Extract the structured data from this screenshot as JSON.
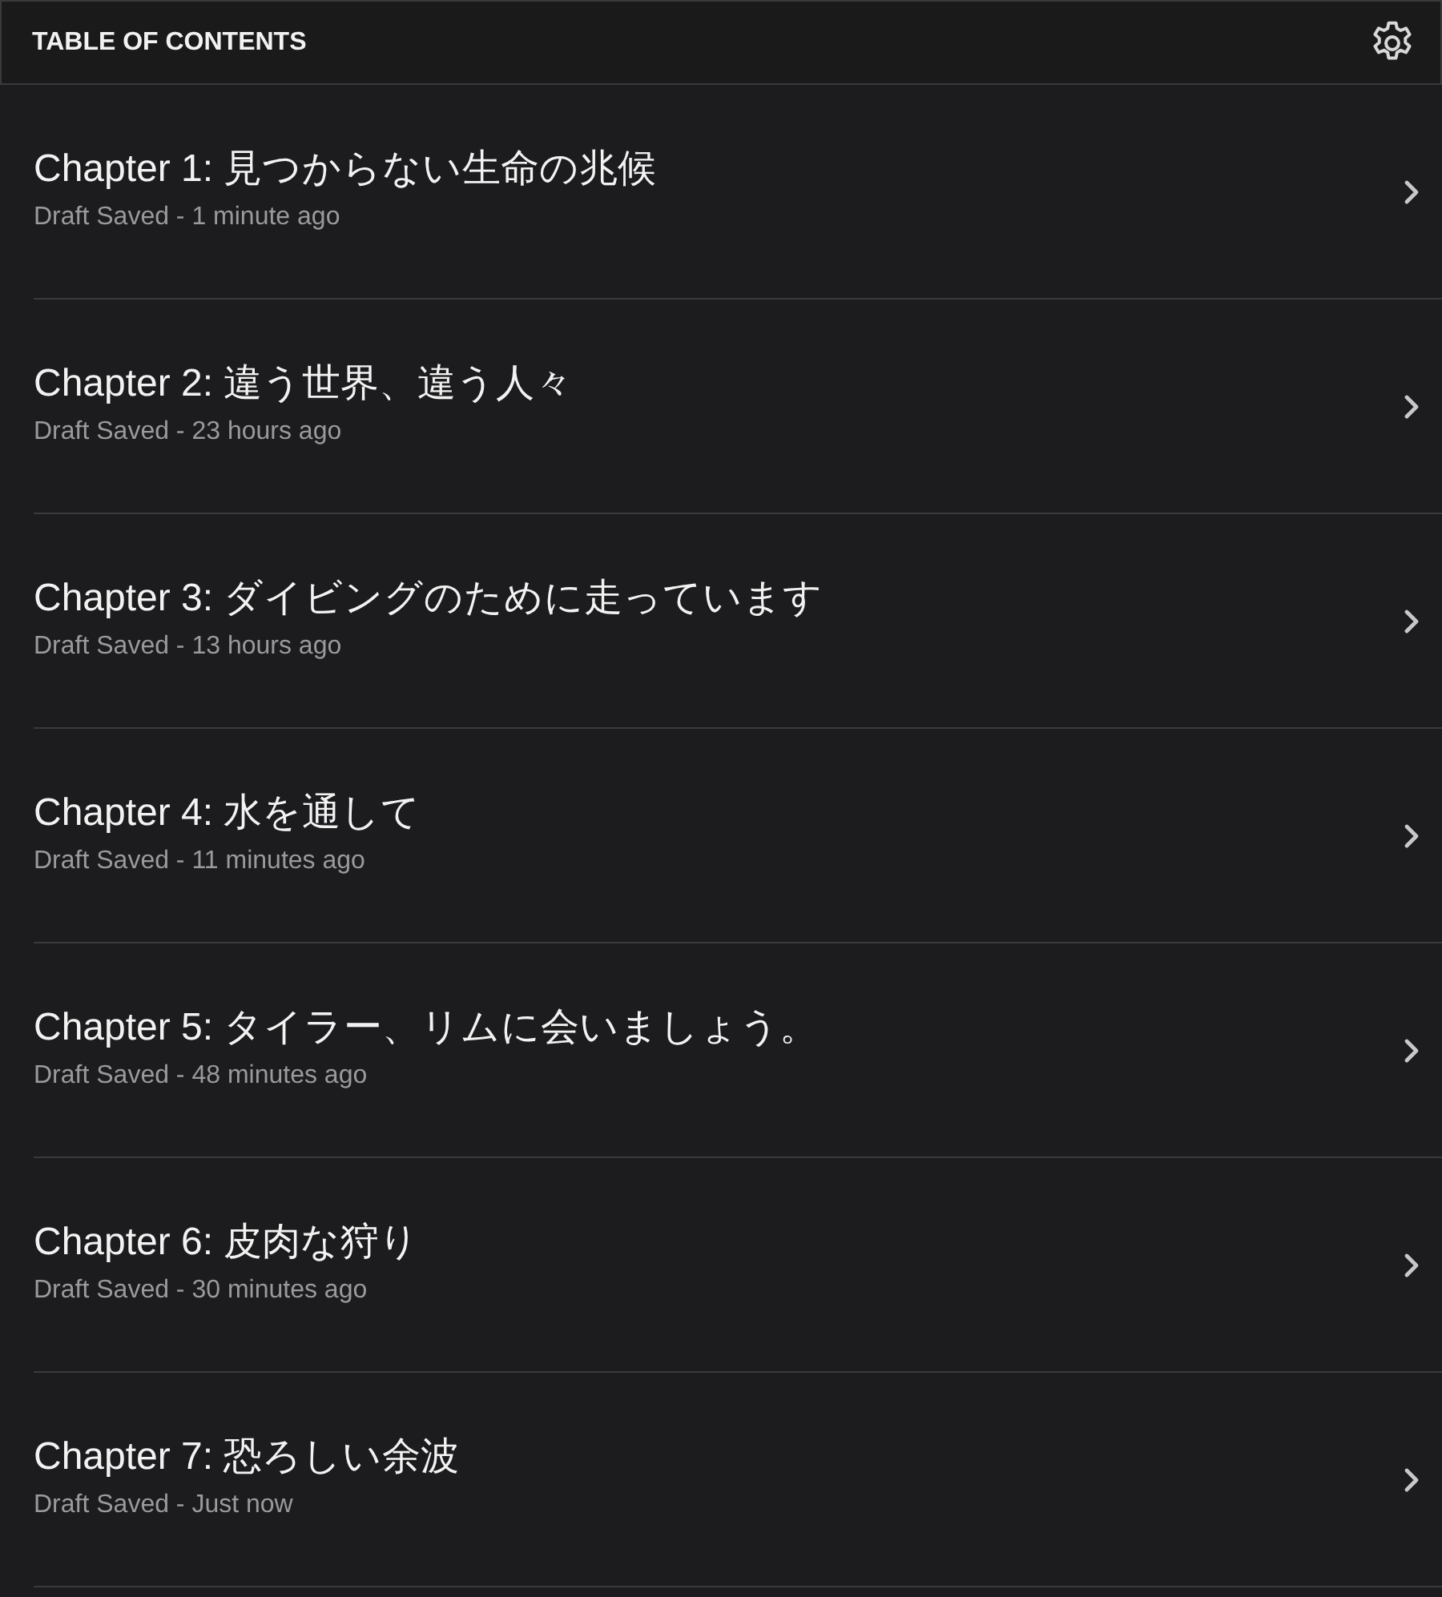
{
  "header": {
    "title": "TABLE OF CONTENTS"
  },
  "chapters": [
    {
      "title": "Chapter 1: 見つからない生命の兆候",
      "status": "Draft Saved - 1 minute ago"
    },
    {
      "title": "Chapter 2: 違う世界、違う人々",
      "status": "Draft Saved - 23 hours ago"
    },
    {
      "title": "Chapter 3: ダイビングのために走っています",
      "status": "Draft Saved - 13 hours ago"
    },
    {
      "title": "Chapter 4: 水を通して",
      "status": "Draft Saved - 11 minutes ago"
    },
    {
      "title": "Chapter 5: タイラー、リムに会いましょう。",
      "status": "Draft Saved - 48 minutes ago"
    },
    {
      "title": "Chapter 6: 皮肉な狩り",
      "status": "Draft Saved - 30 minutes ago"
    },
    {
      "title": "Chapter 7: 恐ろしい余波",
      "status": "Draft Saved - Just now"
    }
  ]
}
